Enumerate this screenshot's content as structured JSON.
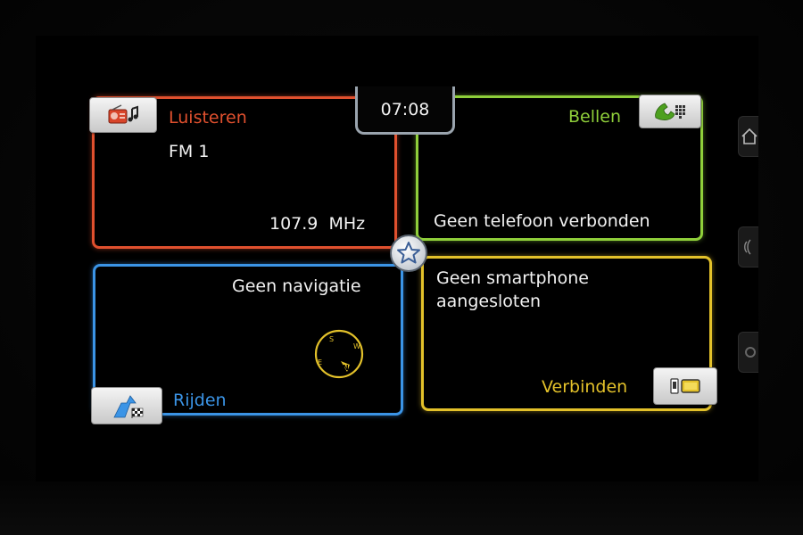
{
  "clock": {
    "time": "07:08"
  },
  "tiles": {
    "listen": {
      "title": "Luisteren",
      "source": "FM 1",
      "frequency": "107.9  MHz",
      "icon": "radio-music-icon"
    },
    "call": {
      "title": "Bellen",
      "status": "Geen telefoon verbonden",
      "icon": "phone-keypad-icon"
    },
    "drive": {
      "title": "Rijden",
      "status": "Geen navigatie",
      "icon": "navigation-flag-icon",
      "compass_icon": "compass-icon"
    },
    "connect": {
      "title": "Verbinden",
      "status_line1": "Geen smartphone",
      "status_line2": "aangesloten",
      "icon": "smartphone-connect-icon"
    }
  },
  "favorite": {
    "icon": "star-icon"
  },
  "side_buttons": [
    "home-icon",
    "voice-icon",
    "settings-icon"
  ],
  "colors": {
    "listen": "#e0502e",
    "call": "#8fcf3a",
    "drive": "#3b94e6",
    "connect": "#e3c12a",
    "background": "#000000"
  }
}
